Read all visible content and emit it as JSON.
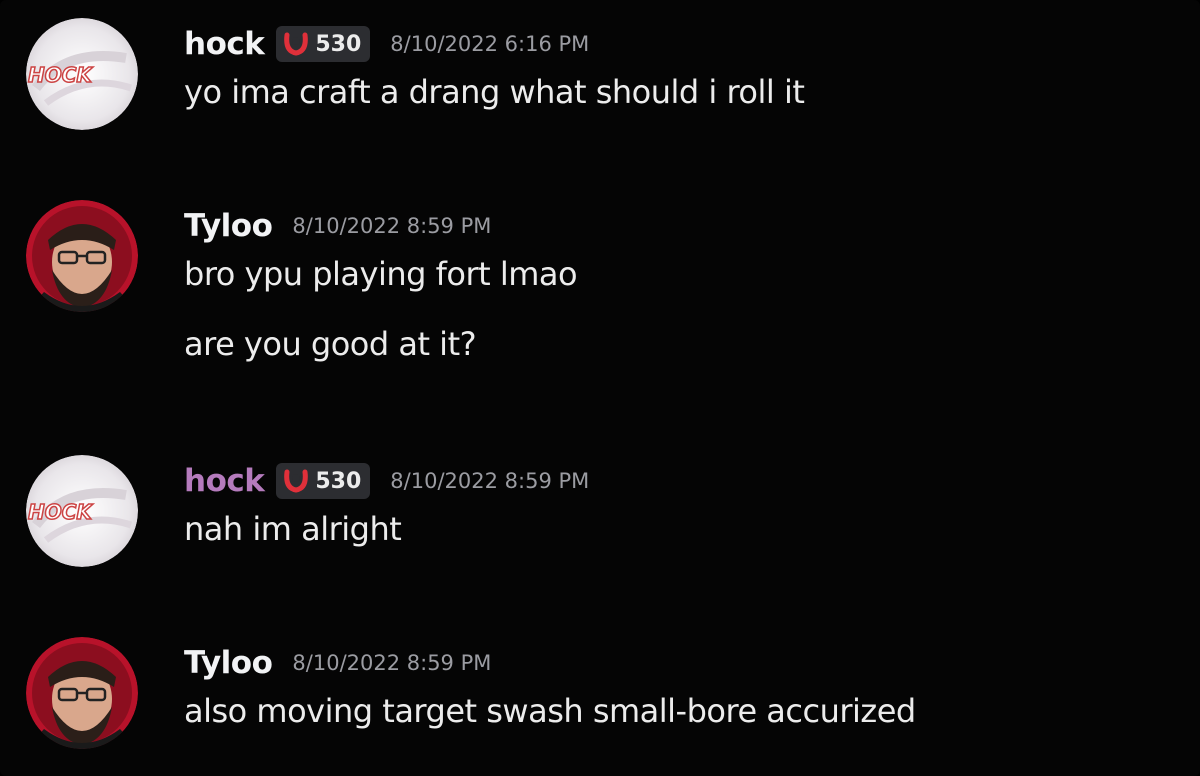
{
  "colors": {
    "background": "#050505",
    "text": "#ececec",
    "timestamp": "#9b9ca2",
    "username_default": "#f2f3f5",
    "username_role_pink": "#b57bbd",
    "badge_bg": "#2c2d31",
    "badge_icon": "#e0303a"
  },
  "messages": [
    {
      "author": "hock",
      "avatar_icon": "hock-logo-avatar",
      "badge_icon": "red-horseshoe-icon",
      "badge_count": "530",
      "timestamp": "8/10/2022 6:16 PM",
      "lines": [
        "yo ima craft a drang what should i roll it"
      ]
    },
    {
      "author": "Tyloo",
      "avatar_icon": "bearded-man-avatar",
      "timestamp": "8/10/2022 8:59 PM",
      "lines": [
        "bro ypu playing fort lmao",
        "are you good at it?"
      ]
    },
    {
      "author": "hock",
      "avatar_icon": "hock-logo-avatar",
      "badge_icon": "red-horseshoe-icon",
      "badge_count": "530",
      "timestamp": "8/10/2022 8:59 PM",
      "lines": [
        "nah im alright"
      ]
    },
    {
      "author": "Tyloo",
      "avatar_icon": "bearded-man-avatar",
      "timestamp": "8/10/2022 8:59 PM",
      "lines": [
        "also moving target swash small-bore accurized"
      ]
    }
  ]
}
